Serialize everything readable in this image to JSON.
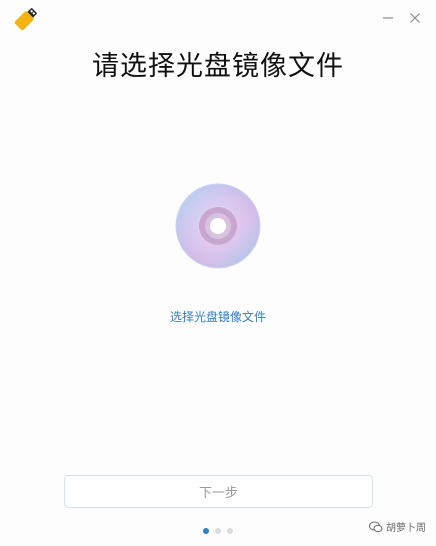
{
  "window": {
    "app_icon": "usb-drive-icon",
    "minimize_icon": "minimize-icon",
    "close_icon": "close-icon"
  },
  "heading": "请选择光盘镜像文件",
  "disc": {
    "icon": "disc-icon"
  },
  "select_link": "选择光盘镜像文件",
  "next_button": "下一步",
  "pagination": {
    "total": 3,
    "current": 1
  },
  "watermark": {
    "icon": "wechat-icon",
    "text": "胡萝卜周"
  },
  "colors": {
    "accent": "#2c7fc9",
    "heading": "#111111",
    "disabled_text": "#9a9a9a",
    "button_border": "#cfe3f5"
  }
}
